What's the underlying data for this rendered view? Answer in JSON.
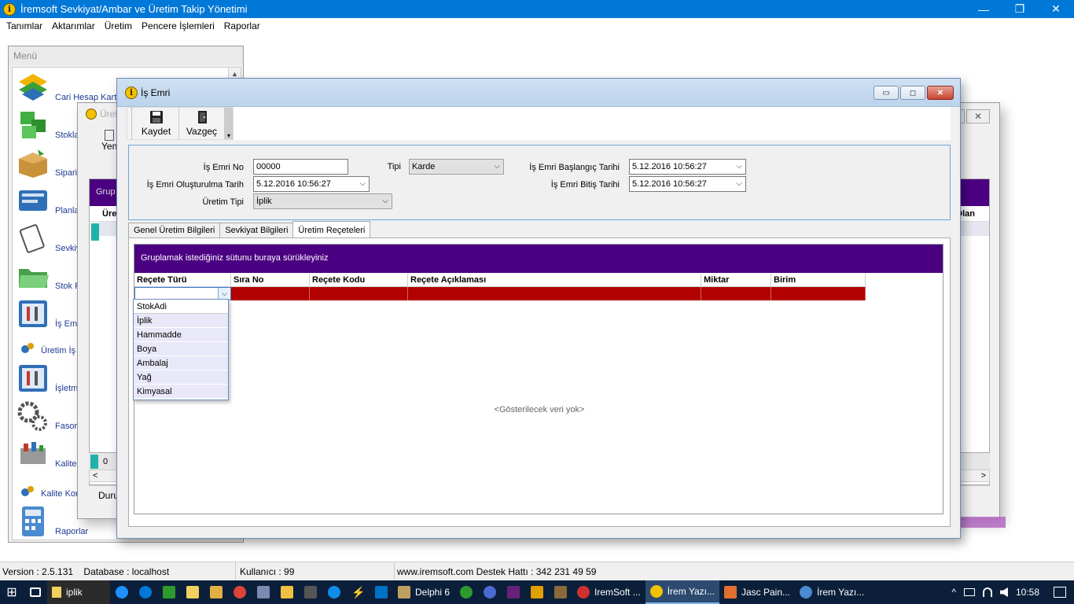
{
  "app": {
    "title": "İremsoft Sevkiyat/Ambar ve Üretim Takip Yönetimi",
    "icon_letter": "i",
    "minimize": "—",
    "maximize": "❐",
    "close": "✕"
  },
  "menubar": [
    "Tanımlar",
    "Aktarımlar",
    "Üretim",
    "Pencere İşlemleri",
    "Raporlar"
  ],
  "menu_panel": {
    "title": "Menü",
    "scroll_up": "▲",
    "items": [
      {
        "label": "Cari Hesap Kart",
        "icon": "cari-hesap-icon",
        "color": "#e0a000"
      },
      {
        "label": "Stokla",
        "icon": "stock-cubes-icon",
        "color": "#2e9a2e"
      },
      {
        "label": "Sipari",
        "icon": "order-box-icon",
        "color": "#c08a3a"
      },
      {
        "label": "Planla",
        "icon": "planning-icon",
        "color": "#2f6fb8"
      },
      {
        "label": "Sevkiy",
        "icon": "clipboard-icon",
        "color": "#8a6a3a"
      },
      {
        "label": "Stok F",
        "icon": "folder-icon",
        "color": "#4aa04a"
      },
      {
        "label": "İş Emi",
        "icon": "work-order-tools-icon",
        "color": "#2f6fb8"
      },
      {
        "label": "Üretim İş E",
        "icon": "small-gears-icon",
        "color": "#2f6fb8"
      },
      {
        "label": "İşletm",
        "icon": "operations-tools-icon",
        "color": "#2f6fb8"
      },
      {
        "label": "Fasor",
        "icon": "gears-icon",
        "color": "#555555"
      },
      {
        "label": "Kalite",
        "icon": "quality-toolbox-icon",
        "color": "#888888"
      },
      {
        "label": "Kalite Kon",
        "icon": "small-gears-icon",
        "color": "#2f6fb8"
      },
      {
        "label": "Raporlar",
        "icon": "calculator-icon",
        "color": "#4a8ad0"
      }
    ]
  },
  "bg_window": {
    "title": "Üreti",
    "close": "✕",
    "toolbar_label": "Yen",
    "group_text": "Grup",
    "header_left": "Üreti",
    "header_right": "Olan",
    "footer_value": "0",
    "scroll_left": "<",
    "scroll_right": ">",
    "status_text": "Duru"
  },
  "fg_window": {
    "title": "İş Emri",
    "icon_letter": "i",
    "btn_min": "▭",
    "btn_max": "◻",
    "btn_close": "✕",
    "toolbar": {
      "save_label": "Kaydet",
      "cancel_label": "Vazgeç",
      "more": "▾"
    },
    "form": {
      "is_emri_no_label": "İş Emri No",
      "is_emri_no_value": "00000",
      "tipi_label": "Tipi",
      "tipi_value": "Karde",
      "baslangic_label": "İş Emri Başlangıç Tarihi",
      "baslangic_value": "5.12.2016 10:56:27",
      "olusturulma_label": "İş Emri Oluşturulma Tarih",
      "olusturulma_value": "5.12.2016 10:56:27",
      "bitis_label": "İş Emri Bitiş Tarihi",
      "bitis_value": "5.12.2016 10:56:27",
      "uretim_tipi_label": "Üretim Tipi",
      "uretim_tipi_value": "İplik",
      "combo_arrow": "⌵"
    },
    "tabs": [
      "Genel Üretim Bilgileri",
      "Sevkiyat Bilgileri",
      "Üretim Reçeteleri"
    ],
    "grid": {
      "group_text": "Gruplamak istediğiniz sütunu buraya sürükleyiniz",
      "columns": [
        "Reçete Türü",
        "Sıra No",
        "Reçete Kodu",
        "Reçete Açıklaması",
        "Miktar",
        "Birim"
      ],
      "empty_text": "<Gösterilecek veri yok>",
      "dropdown_btn": "⌵",
      "dropdown": {
        "header": "StokAdi",
        "options": [
          "İplik",
          "Hammadde",
          "Boya",
          "Ambalaj",
          "Yağ",
          "Kimyasal"
        ]
      }
    }
  },
  "statusbar": {
    "version": "Version : 2.5.131",
    "database": "Database :  localhost",
    "user": "Kullanıcı : 99",
    "contact": "www.iremsoft.com  Destek Hattı : 342 231 49 59"
  },
  "taskbar": {
    "start": "⊞",
    "search_text": "iplik",
    "items": [
      "Delphi 6",
      "IremSoft ...",
      "İrem Yazı...",
      "Jasc Pain...",
      "İrem Yazı..."
    ],
    "clock": "10:58",
    "show_desktop": "^"
  }
}
